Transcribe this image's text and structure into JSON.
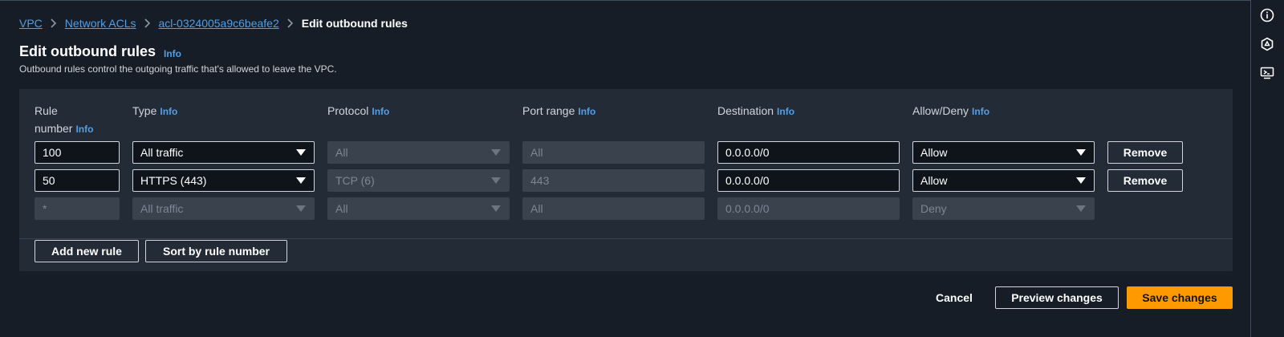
{
  "breadcrumb": {
    "items": [
      "VPC",
      "Network ACLs",
      "acl-0324005a9c6beafe2"
    ],
    "current": "Edit outbound rules"
  },
  "header": {
    "title": "Edit outbound rules",
    "info": "Info",
    "description": "Outbound rules control the outgoing traffic that's allowed to leave the VPC."
  },
  "columns": {
    "rule_number_line1": "Rule",
    "rule_number_line2": "number",
    "type": "Type",
    "protocol": "Protocol",
    "port_range": "Port range",
    "destination": "Destination",
    "allow_deny": "Allow/Deny",
    "info": "Info"
  },
  "rules": [
    {
      "rule_number": "100",
      "type": "All traffic",
      "protocol": "All",
      "port_range": "All",
      "destination": "0.0.0.0/0",
      "allow_deny": "Allow",
      "remove": "Remove"
    },
    {
      "rule_number": "50",
      "type": "HTTPS (443)",
      "protocol": "TCP (6)",
      "port_range": "443",
      "destination": "0.0.0.0/0",
      "allow_deny": "Allow",
      "remove": "Remove"
    },
    {
      "rule_number": "*",
      "type": "All traffic",
      "protocol": "All",
      "port_range": "All",
      "destination": "0.0.0.0/0",
      "allow_deny": "Deny"
    }
  ],
  "panel_actions": {
    "add_rule": "Add new rule",
    "sort": "Sort by rule number"
  },
  "footer": {
    "cancel": "Cancel",
    "preview": "Preview changes",
    "save": "Save changes"
  },
  "rail": {
    "icons": [
      "info-icon",
      "settings-hexagon-icon",
      "feedback-screen-icon"
    ]
  },
  "colors": {
    "background": "#161d26",
    "panel": "#232b37",
    "link": "#539fe5",
    "primary": "#ff9900"
  }
}
